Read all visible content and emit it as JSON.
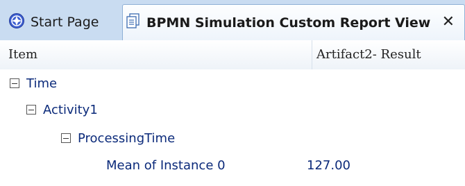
{
  "tabs": {
    "start_page": {
      "label": "Start Page",
      "icon": "start-page-icon"
    },
    "report_view": {
      "label": "BPMN Simulation Custom Report View",
      "icon": "report-document-icon",
      "close": "✕"
    }
  },
  "columns": {
    "item": "Item",
    "result": "Artifact2- Result"
  },
  "tree": {
    "time": "Time",
    "activity": "Activity1",
    "processing_time": "ProcessingTime",
    "leaf": {
      "label": "Mean of Instance 0",
      "value": "127.00"
    }
  }
}
